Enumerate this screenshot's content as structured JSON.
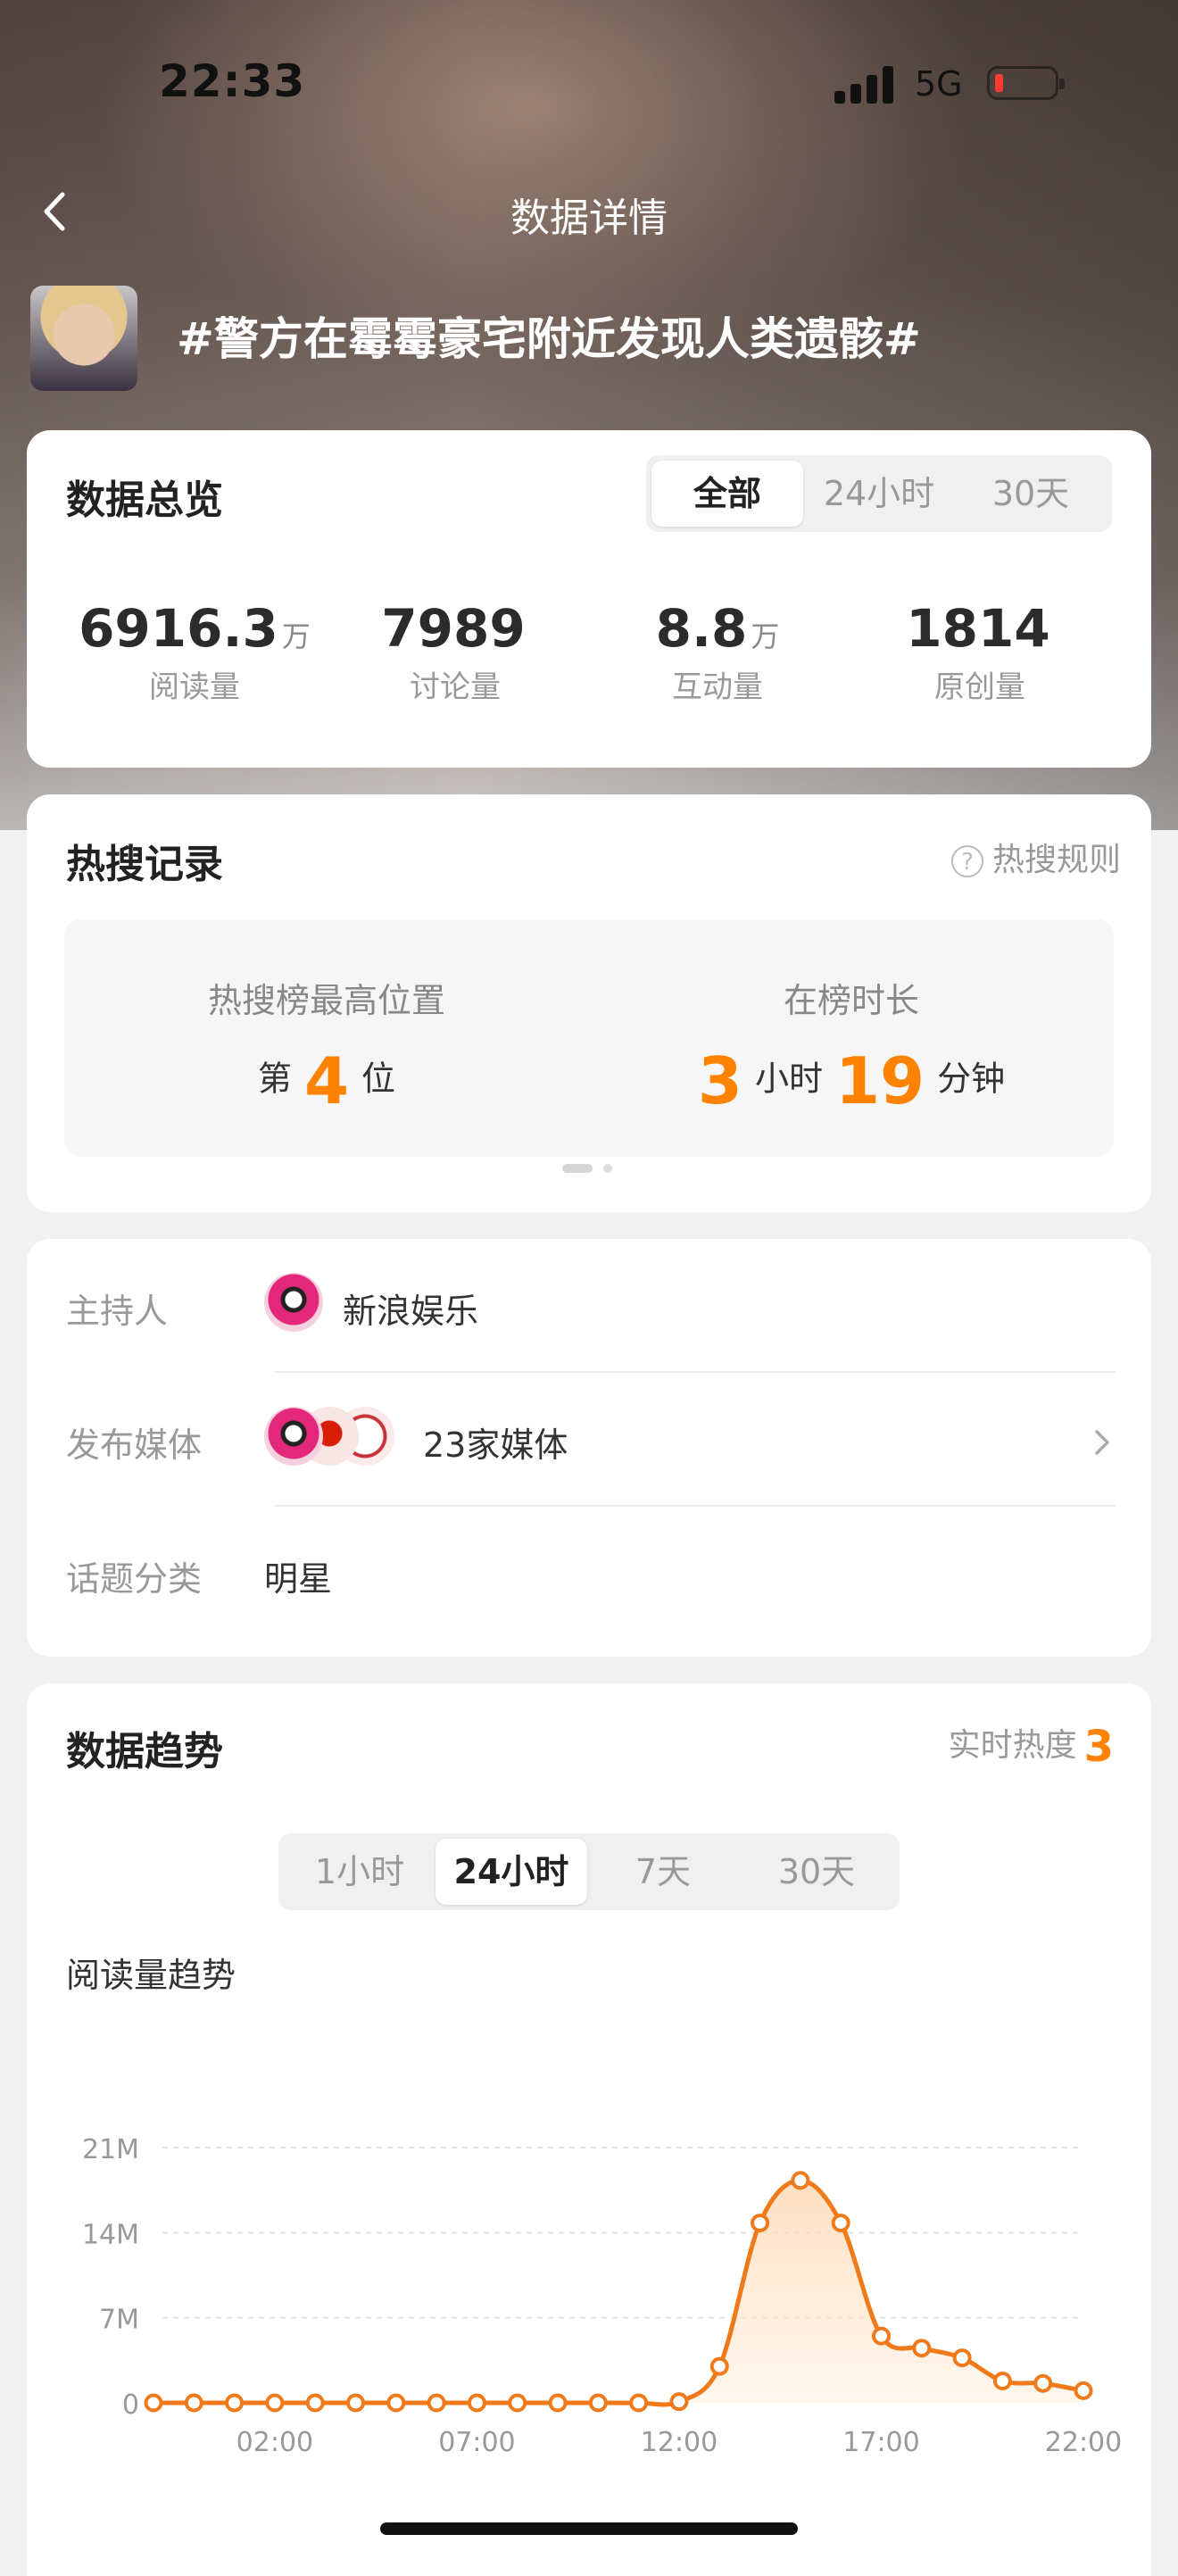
{
  "status": {
    "time": "22:33",
    "network": "5G"
  },
  "nav": {
    "title": "数据详情"
  },
  "topic": {
    "title": "#警方在霉霉豪宅附近发现人类遗骸#"
  },
  "overview": {
    "title": "数据总览",
    "tabs": [
      "全部",
      "24小时",
      "30天"
    ],
    "active_tab": "全部",
    "stats": [
      {
        "value": "6916.3",
        "unit": "万",
        "label": "阅读量"
      },
      {
        "value": "7989",
        "unit": "",
        "label": "讨论量"
      },
      {
        "value": "8.8",
        "unit": "万",
        "label": "互动量"
      },
      {
        "value": "1814",
        "unit": "",
        "label": "原创量"
      }
    ]
  },
  "hot": {
    "title": "热搜记录",
    "rules_label": "热搜规则",
    "peak_label": "热搜榜最高位置",
    "peak_prefix": "第",
    "peak_value": "4",
    "peak_suffix": "位",
    "duration_label": "在榜时长",
    "hours_value": "3",
    "hours_unit": "小时",
    "minutes_value": "19",
    "minutes_unit": "分钟"
  },
  "info": {
    "host_label": "主持人",
    "host_value": "新浪娱乐",
    "media_label": "发布媒体",
    "media_value": "23家媒体",
    "category_label": "话题分类",
    "category_value": "明星"
  },
  "trend": {
    "title": "数据趋势",
    "heat_label": "实时热度",
    "heat_value": "3",
    "tabs": [
      "1小时",
      "24小时",
      "7天",
      "30天"
    ],
    "active_tab": "24小时",
    "chart_title": "阅读量趋势"
  },
  "colors": {
    "accent": "#ff8200",
    "line": "#f07a1a"
  },
  "chart_data": {
    "type": "line",
    "title": "阅读量趋势",
    "xlabel": "",
    "ylabel": "",
    "ylim": [
      0,
      21
    ],
    "y_ticks": [
      "0",
      "7M",
      "14M",
      "21M"
    ],
    "y_tick_values": [
      0,
      7,
      14,
      21
    ],
    "x_ticks": [
      "02:00",
      "07:00",
      "12:00",
      "17:00",
      "22:00"
    ],
    "x_tick_values": [
      2,
      7,
      12,
      17,
      22
    ],
    "grid": true,
    "series": [
      {
        "values": [
          [
            -1,
            0
          ],
          [
            0,
            0
          ],
          [
            1,
            0
          ],
          [
            2,
            0
          ],
          [
            3,
            0
          ],
          [
            4,
            0
          ],
          [
            5,
            0
          ],
          [
            6,
            0
          ],
          [
            7,
            0
          ],
          [
            8,
            0
          ],
          [
            9,
            0
          ],
          [
            10,
            0
          ],
          [
            11,
            0
          ],
          [
            12,
            0.1
          ],
          [
            13,
            3
          ],
          [
            14,
            14.8
          ],
          [
            15,
            18.3
          ],
          [
            16,
            14.8
          ],
          [
            17,
            5.5
          ],
          [
            18,
            4.5
          ],
          [
            19,
            3.7
          ],
          [
            20,
            1.8
          ],
          [
            21,
            1.6
          ],
          [
            22,
            1
          ]
        ]
      }
    ]
  }
}
